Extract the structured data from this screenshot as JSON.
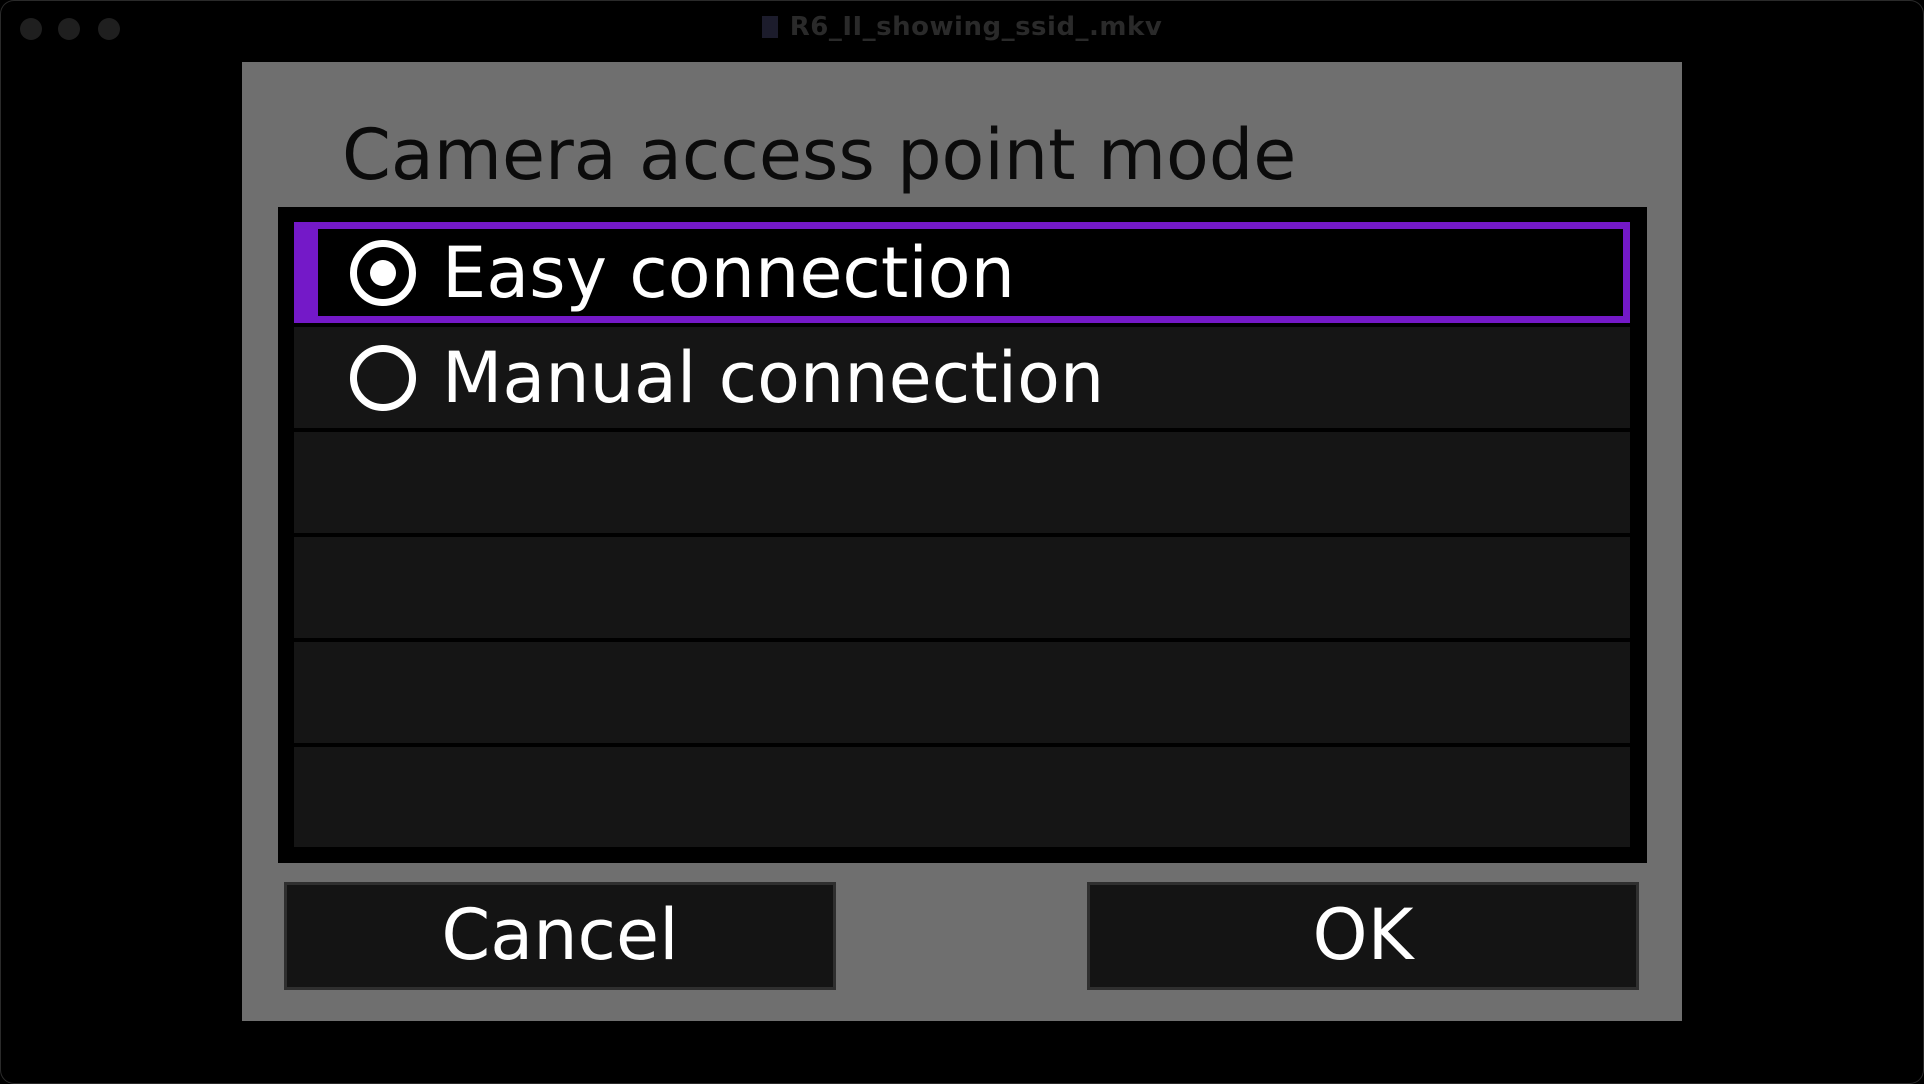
{
  "window": {
    "title": "R6_II_showing_ssid_.mkv"
  },
  "dialog": {
    "title": "Camera access point mode",
    "options": [
      {
        "label": "Easy connection",
        "selected": true
      },
      {
        "label": "Manual connection",
        "selected": false
      }
    ],
    "buttons": {
      "cancel": "Cancel",
      "ok": "OK"
    }
  },
  "colors": {
    "selection_accent": "#7419c8",
    "dialog_background": "#6f6f6f",
    "list_background": "#000000"
  }
}
